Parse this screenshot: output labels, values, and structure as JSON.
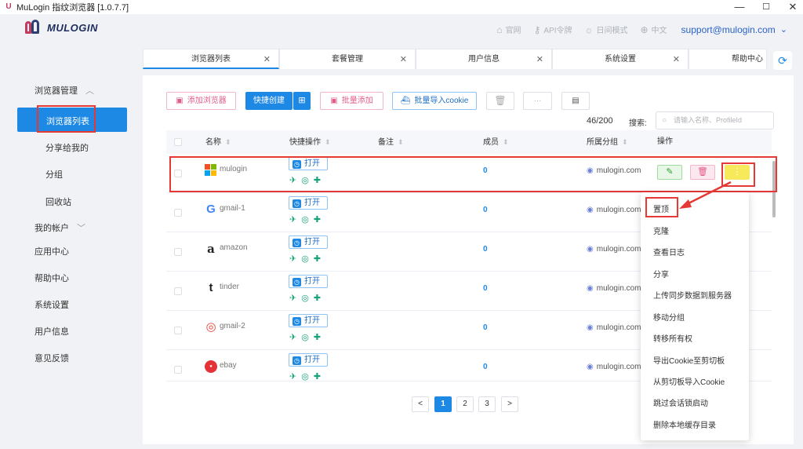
{
  "window": {
    "title": "MuLogin 指纹浏览器 [1.0.7.7]",
    "min": "—",
    "max": "☐",
    "close": "✕"
  },
  "brand": {
    "name": "MULOGIN"
  },
  "topnav": {
    "items": [
      {
        "icon": "home-icon",
        "label": "官网"
      },
      {
        "icon": "key-icon",
        "label": "API令牌"
      },
      {
        "icon": "sun-icon",
        "label": "日间模式"
      },
      {
        "icon": "globe-icon",
        "label": "中文"
      }
    ],
    "email": "support@mulogin.com"
  },
  "sidebar": {
    "browser_mgmt": "浏览器管理",
    "browser_list": "浏览器列表",
    "shared": "分享给我的",
    "group": "分组",
    "recycle": "回收站",
    "account": "我的帐户",
    "app_center": "应用中心",
    "help": "帮助中心",
    "settings": "系统设置",
    "user_info": "用户信息",
    "feedback": "意见反馈"
  },
  "tabs": [
    {
      "label": "浏览器列表"
    },
    {
      "label": "套餐管理"
    },
    {
      "label": "用户信息"
    },
    {
      "label": "系统设置"
    },
    {
      "label": "帮助中心"
    }
  ],
  "toolbar": {
    "add_browser": "添加浏览器",
    "quick_create": "快捷创建",
    "batch_add": "批量添加",
    "import_cookie": "批量导入cookie",
    "count": "46/200",
    "search_label": "搜索:",
    "search_placeholder": "请输入名称、ProfileId"
  },
  "table": {
    "headers": {
      "name": "名称",
      "quick": "快捷操作",
      "remark": "备注",
      "member": "成员",
      "group": "所属分组",
      "action": "操作"
    },
    "open_label": "打开",
    "rows": [
      {
        "name": "mulogin",
        "member": "0",
        "group": "mulogin.com"
      },
      {
        "name": "gmail-1",
        "member": "0",
        "group": "mulogin.com"
      },
      {
        "name": "amazon",
        "member": "0",
        "group": "mulogin.com"
      },
      {
        "name": "tinder",
        "member": "0",
        "group": "mulogin.com"
      },
      {
        "name": "gmail-2",
        "member": "0",
        "group": "mulogin.com"
      },
      {
        "name": "ebay",
        "member": "0",
        "group": "mulogin.com"
      }
    ]
  },
  "pagination": {
    "prev": "<",
    "pages": [
      "1",
      "2",
      "3"
    ],
    "next": ">",
    "current": "1"
  },
  "context_menu": [
    "置顶",
    "克隆",
    "查看日志",
    "分享",
    "上传同步数据到服务器",
    "移动分组",
    "转移所有权",
    "导出Cookie至剪切板",
    "从剪切板导入Cookie",
    "跳过会话锁启动",
    "删除本地缓存目录"
  ],
  "colors": {
    "accent": "#1e88e5",
    "highlight": "#e53935"
  }
}
